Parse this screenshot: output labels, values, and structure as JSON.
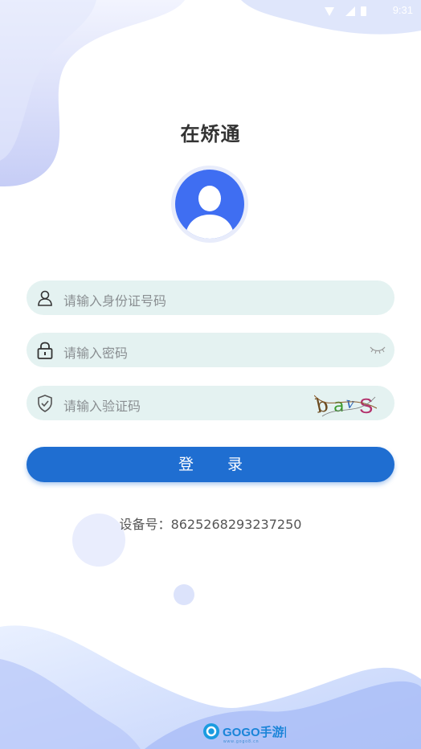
{
  "status_bar": {
    "time": "9:31"
  },
  "app_title": "在矫通",
  "form": {
    "id_placeholder": "请输入身份证号码",
    "password_placeholder": "请输入密码",
    "captcha_placeholder": "请输入验证码",
    "captcha_text": "bavS"
  },
  "login_label": "登 录",
  "device": {
    "label": "设备号：",
    "number": "8625268293237250"
  },
  "watermark": {
    "text": "GOGO手游网",
    "url": "www.gogo8.cn"
  },
  "colors": {
    "primary": "#1f6ed1",
    "field_bg": "#e4f2f1",
    "accent_wave": "#c9d3fa"
  }
}
